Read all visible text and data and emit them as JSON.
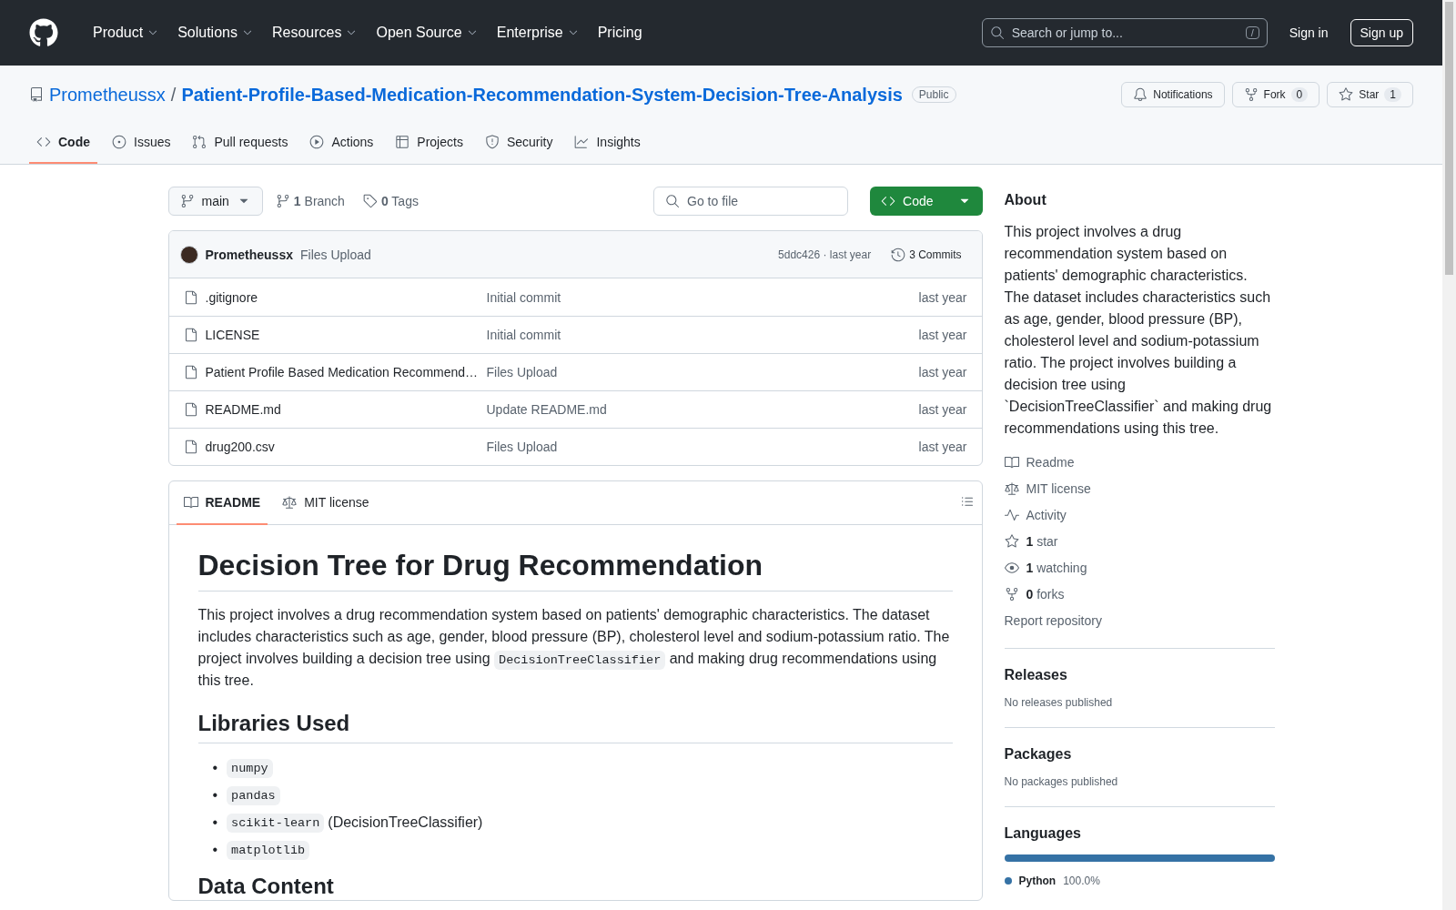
{
  "header": {
    "nav": [
      {
        "label": "Product",
        "dropdown": true
      },
      {
        "label": "Solutions",
        "dropdown": true
      },
      {
        "label": "Resources",
        "dropdown": true
      },
      {
        "label": "Open Source",
        "dropdown": true
      },
      {
        "label": "Enterprise",
        "dropdown": true
      },
      {
        "label": "Pricing",
        "dropdown": false
      }
    ],
    "search": {
      "placeholder": "Search or jump to...",
      "shortcut": "/"
    },
    "sign_in": "Sign in",
    "sign_up": "Sign up"
  },
  "repo": {
    "owner": "Prometheussx",
    "separator": "/",
    "name": "Patient-Profile-Based-Medication-Recommendation-System-Decision-Tree-Analysis",
    "visibility": "Public",
    "actions": [
      {
        "label": "Notifications"
      },
      {
        "label": "Fork",
        "count": "0"
      },
      {
        "label": "Star",
        "count": "1"
      }
    ]
  },
  "tabs": [
    {
      "label": "Code",
      "selected": true
    },
    {
      "label": "Issues",
      "selected": false
    },
    {
      "label": "Pull requests",
      "selected": false
    },
    {
      "label": "Actions",
      "selected": false
    },
    {
      "label": "Projects",
      "selected": false
    },
    {
      "label": "Security",
      "selected": false
    },
    {
      "label": "Insights",
      "selected": false
    }
  ],
  "toolbar": {
    "branch": "main",
    "branches": "**1** Branch",
    "tags": "**0** Tags",
    "go_to_file": "Go to file",
    "code_button": "Code"
  },
  "commit": {
    "author": "Prometheussx",
    "message": "Files Upload",
    "hash": "5ddc426 · last year",
    "commits": "3 Commits"
  },
  "files": [
    {
      "name": ".gitignore",
      "message": "Initial commit",
      "time": "last year"
    },
    {
      "name": "LICENSE",
      "message": "Initial commit",
      "time": "last year"
    },
    {
      "name": "Patient Profile Based Medication Recommend…",
      "message": "Files Upload",
      "time": "last year"
    },
    {
      "name": "README.md",
      "message": "Update README.md",
      "time": "last year"
    },
    {
      "name": "drug200.csv",
      "message": "Files Upload",
      "time": "last year"
    }
  ],
  "readme_tabs": [
    {
      "label": "README",
      "selected": true
    },
    {
      "label": "MIT license",
      "selected": false
    }
  ],
  "readme": {
    "title": "Decision Tree for Drug Recommendation",
    "paragraph": [
      {
        "kind": "text",
        "text": "This project involves a drug recommendation system based on patients' demographic characteristics. The dataset includes characteristics such as age, gender, blood pressure (BP), cholesterol level and sodium-potassium ratio. The project involves building a decision tree using "
      },
      {
        "kind": "code",
        "text": "DecisionTreeClassifier"
      },
      {
        "kind": "text",
        "text": " and making drug recommendations using this tree."
      }
    ],
    "libraries_title": "Libraries Used",
    "bullet": "•",
    "libraries": [
      {
        "code": "numpy"
      },
      {
        "code": "pandas"
      },
      {
        "code": "scikit-learn",
        "note": "(DecisionTreeClassifier)"
      },
      {
        "code": "matplotlib"
      }
    ],
    "next_title": "Data Content"
  },
  "about": {
    "title": "About",
    "description": "This project involves a drug recommendation system based on patients' demographic characteristics. The dataset includes characteristics such as age, gender, blood pressure (BP), cholesterol level and sodium-potassium ratio. The project involves building a decision tree using `DecisionTreeClassifier` and making drug recommendations using this tree.",
    "links": [
      "Readme",
      "MIT license",
      "Activity",
      "**1** star",
      "**1** watching",
      "**0** forks"
    ],
    "report": "Report repository"
  },
  "releases": {
    "title": "Releases",
    "note": "No releases published"
  },
  "packages": {
    "title": "Packages",
    "note": "No packages published"
  },
  "languages": {
    "title": "Languages",
    "items": [
      {
        "name": "Python",
        "percent": "100.0%",
        "color": "#3572a5",
        "level": 1.0
      }
    ]
  }
}
